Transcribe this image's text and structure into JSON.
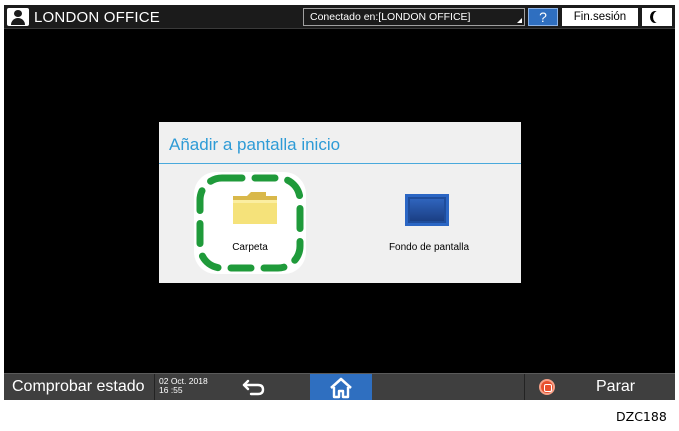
{
  "topbar": {
    "user_name": "LONDON OFFICE",
    "connected_label": "Conectado en:[LONDON OFFICE]",
    "help_label": "?",
    "logout_label": "Fin.sesión"
  },
  "dialog": {
    "title": "Añadir a pantalla inicio",
    "items": [
      {
        "label": "Carpeta",
        "icon": "folder-icon",
        "highlighted": true
      },
      {
        "label": "Fondo de pantalla",
        "icon": "wallpaper-icon",
        "highlighted": false
      }
    ]
  },
  "bottombar": {
    "check_status_label": "Comprobar estado",
    "date": "02 Oct. 2018",
    "time": "16 :55",
    "stop_label": "Parar"
  },
  "figure_code": "DZC188",
  "colors": {
    "accent_blue": "#2f6fc0",
    "title_blue": "#2e9bd6",
    "highlight_green": "#1f9a3a",
    "stop_red": "#e8502e"
  }
}
